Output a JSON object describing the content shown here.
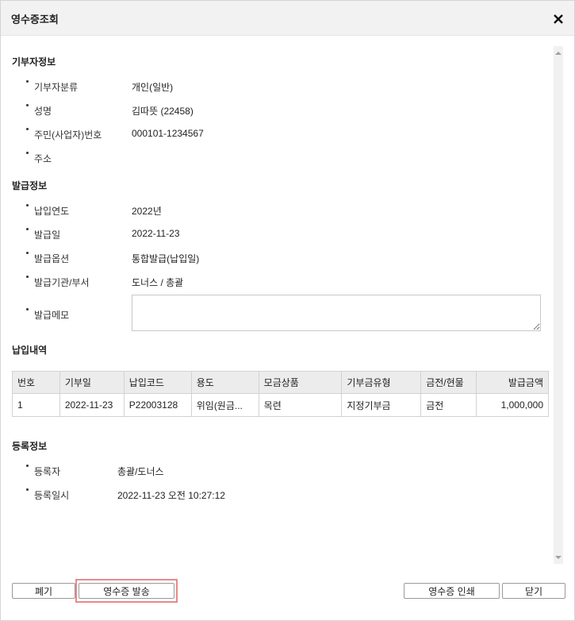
{
  "dialog": {
    "title": "영수증조회",
    "close_symbol": "✕"
  },
  "donor": {
    "section_title": "기부자정보",
    "fields": [
      {
        "label": "기부자분류",
        "value": "개인(일반)"
      },
      {
        "label": "성명",
        "value": "김따뜻 (22458)"
      },
      {
        "label": "주민(사업자)번호",
        "value": "000101-1234567"
      },
      {
        "label": "주소",
        "value": ""
      }
    ]
  },
  "issue": {
    "section_title": "발급정보",
    "fields": [
      {
        "label": "납입연도",
        "value": "2022년"
      },
      {
        "label": "발급일",
        "value": "2022-11-23"
      },
      {
        "label": "발급옵션",
        "value": "통합발급(납입일)"
      },
      {
        "label": "발급기관/부서",
        "value": "도너스 / 총괄"
      },
      {
        "label": "발급메모",
        "value": ""
      }
    ]
  },
  "payments": {
    "section_title": "납입내역",
    "columns": [
      "번호",
      "기부일",
      "납입코드",
      "용도",
      "모금상품",
      "기부금유형",
      "금전/현물",
      "발급금액"
    ],
    "rows": [
      [
        "1",
        "2022-11-23",
        "P22003128",
        "위임(원금...",
        "목련",
        "지정기부금",
        "금전",
        "1,000,000"
      ]
    ]
  },
  "registration": {
    "section_title": "등록정보",
    "fields": [
      {
        "label": "등록자",
        "value": "총괄/도너스"
      },
      {
        "label": "등록일시",
        "value": "2022-11-23 오전 10:27:12"
      }
    ]
  },
  "buttons": {
    "discard": "폐기",
    "send_receipt": "영수증 발송",
    "print_receipt": "영수증 인쇄",
    "close": "닫기"
  }
}
